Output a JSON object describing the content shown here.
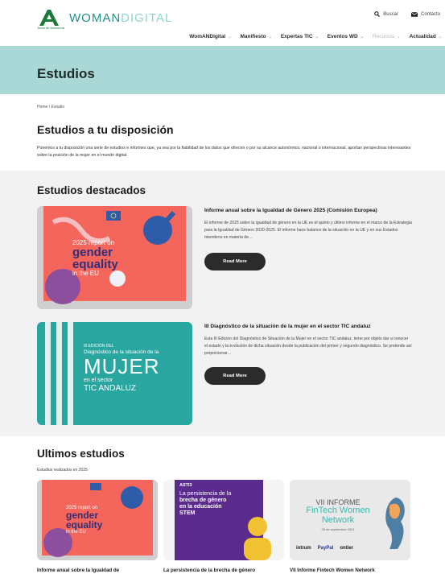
{
  "header": {
    "logo_main": "WOMAN",
    "logo_accent": "DIGITAL",
    "logo_sub": "Junta de Andalucía",
    "search_label": "Buscar",
    "contact_label": "Contacto"
  },
  "nav": {
    "items": [
      {
        "label": "WomANDigital"
      },
      {
        "label": "Manifiesto"
      },
      {
        "label": "Expertas TIC"
      },
      {
        "label": "Eventos WD"
      },
      {
        "label": "Recursos"
      },
      {
        "label": "Actualidad"
      }
    ]
  },
  "banner": {
    "title": "Estudios"
  },
  "breadcrumb": "Home / Estudio",
  "intro": {
    "title": "Estudios a tu disposición",
    "text": "Ponemos a tu disposición una serie de estudios e informes que, ya sea por la fiabilidad de los datos que ofrecen o por su alcance autonómico, nacional o internacional, aportan perspectivas interesantes sobre la posición de la mujer en el mundo digital."
  },
  "featured": {
    "title": "Estudios destacados",
    "items": [
      {
        "heading": "Informe anual sobre la Igualdad de Género 2025 (Comisión Europea)",
        "body": "El informe de 2025 sobre la igualdad de género en la UE es el quinto y último informe en el marco de la Estrategia para la Igualdad de Género 2020-2025. El informe hace balance de la situación en la UE y en sus Estados miembros en materia de…",
        "button": "Read More",
        "image": {
          "line1": "2025 report on",
          "line2": "gender",
          "line3": "equality",
          "line4": "in the EU"
        }
      },
      {
        "heading": "III Diagnóstico de la situación de la mujer en el sector TIC andaluz",
        "body": "Esta III Edición del Diagnóstico de Situación de la Mujer en el sector TIC andaluz, tiene por objeto dar a conocer el estado y la evolución de dicha situación desde la publicación del primer  y segundo diagnóstico. Se pretende así proporcionar…",
        "button": "Read More",
        "image": {
          "line1": "III EDICIÓN DEL",
          "line2": "Diagnóstico de la situación de la",
          "line3": "MUJER",
          "line4": "en el sector",
          "line5": "TIC ANDALUZ"
        }
      }
    ]
  },
  "latest": {
    "title": "Ultimos estudios",
    "subtitle": "Estudios realizados en 2025",
    "items": [
      {
        "caption": "Informe anual sobre la Igualdad de",
        "image": {
          "line1": "2025 report on",
          "line2": "gender",
          "line3": "equality",
          "line4": "in the EU"
        }
      },
      {
        "caption": "La persistencia de la brecha de género",
        "image": {
          "tag": "ASTI3",
          "line1": "La persistencia de la",
          "line2": "brecha de género",
          "line3": "en la educación",
          "line4": "STEM"
        }
      },
      {
        "caption": "VII Informe Fintech Women Network",
        "image": {
          "line1": "VII INFORME",
          "line2": "FinTech Women",
          "line3": "Network",
          "line4": "25 de septiembre 2024",
          "line5": "intrum",
          "line6": "PayPal",
          "line7": "ontier"
        }
      }
    ]
  },
  "colors": {
    "banner": "#a9d8d6",
    "accent": "#1f8f8a",
    "button": "#2b2b2b",
    "featured_bg": "#f2f2f2"
  }
}
